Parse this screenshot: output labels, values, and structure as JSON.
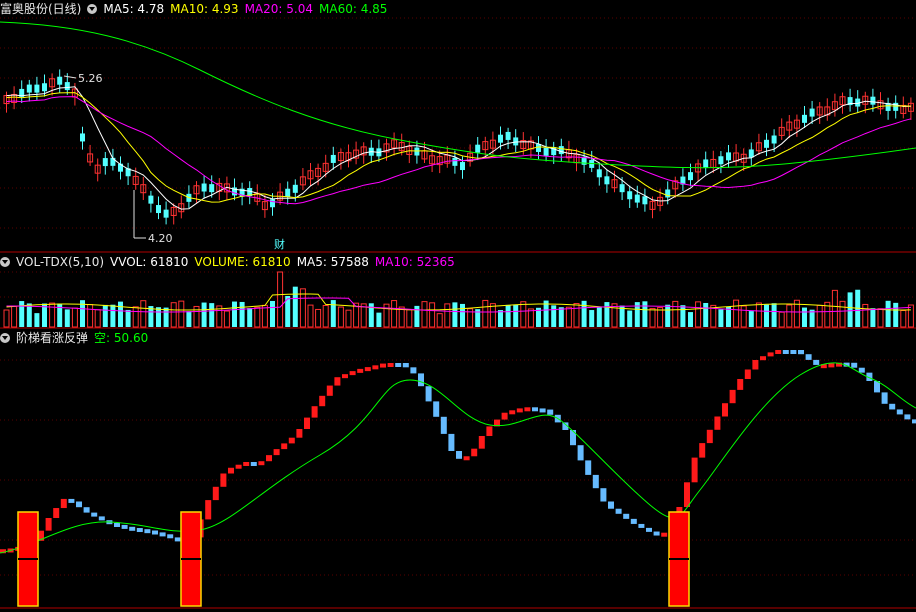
{
  "panels": {
    "price": {
      "title": "富奥股份(日线)",
      "indicators": [
        {
          "label": "MA5: 4.78",
          "color": "#ffffff"
        },
        {
          "label": "MA10: 4.93",
          "color": "#ffff00"
        },
        {
          "label": "MA20: 5.04",
          "color": "#ff00ff"
        },
        {
          "label": "MA60: 4.85",
          "color": "#00ff00"
        }
      ],
      "high_label": "5.26",
      "low_label": "4.20",
      "event_label": "财"
    },
    "volume": {
      "title": "VOL-TDX(5,10)",
      "indicators": [
        {
          "label": "VVOL: 61810",
          "color": "#ffffff"
        },
        {
          "label": "VOLUME: 61810",
          "color": "#ffff00"
        },
        {
          "label": "MA5: 57588",
          "color": "#ffffff"
        },
        {
          "label": "MA10: 52365",
          "color": "#ff00ff"
        }
      ]
    },
    "ladder": {
      "title": "阶梯看涨反弹",
      "indicators": [
        {
          "label": "空: 50.60",
          "color": "#00ff00"
        }
      ]
    }
  },
  "colors": {
    "up": "#ff3232",
    "down": "#54ffff",
    "ladder_up": "#ff1a1a",
    "ladder_down": "#66bbff",
    "signal_fill": "#ff0000",
    "signal_border": "#ffd700",
    "ma5": "#ffffff",
    "ma10": "#ffff00",
    "ma20": "#ff00ff",
    "ma60": "#00ff00"
  }
}
